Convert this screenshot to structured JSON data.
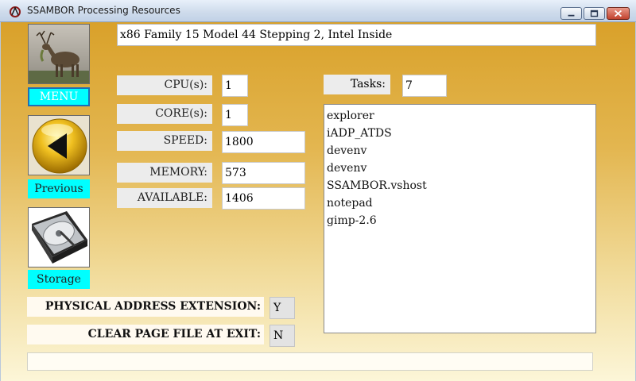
{
  "window": {
    "title": "SSAMBOR Processing Resources"
  },
  "nav": {
    "menu_label": "MENU",
    "previous_label": "Previous",
    "storage_label": "Storage"
  },
  "cpu": {
    "name": "x86 Family 15 Model 44 Stepping 2, Intel Inside",
    "cpus_label": "CPU(s):",
    "cpus_value": "1",
    "cores_label": "CORE(s):",
    "cores_value": "1",
    "speed_label": "SPEED:",
    "speed_value": "1800",
    "memory_label": "MEMORY:",
    "memory_value": "573",
    "available_label": "AVAILABLE:",
    "available_value": "1406"
  },
  "tasks": {
    "label": "Tasks:",
    "count": "7",
    "items": [
      "explorer",
      "iADP_ATDS",
      "devenv",
      "devenv",
      "SSAMBOR.vshost",
      "notepad",
      "gimp-2.6"
    ]
  },
  "flags": {
    "pae_label": "PHYSICAL ADDRESS EXTENSION:",
    "pae_value": "Y",
    "clear_pagefile_label": "CLEAR PAGE FILE AT EXIT:",
    "clear_pagefile_value": "N"
  },
  "icons": {
    "app": "app-icon",
    "menu_image": "deer-photo-icon",
    "previous_image": "back-arrow-icon",
    "storage_image": "hard-drive-icon"
  },
  "colors": {
    "background_top": "#d9a12a",
    "background_bottom": "#fcf6d8",
    "nav_label": "#00ffff"
  }
}
